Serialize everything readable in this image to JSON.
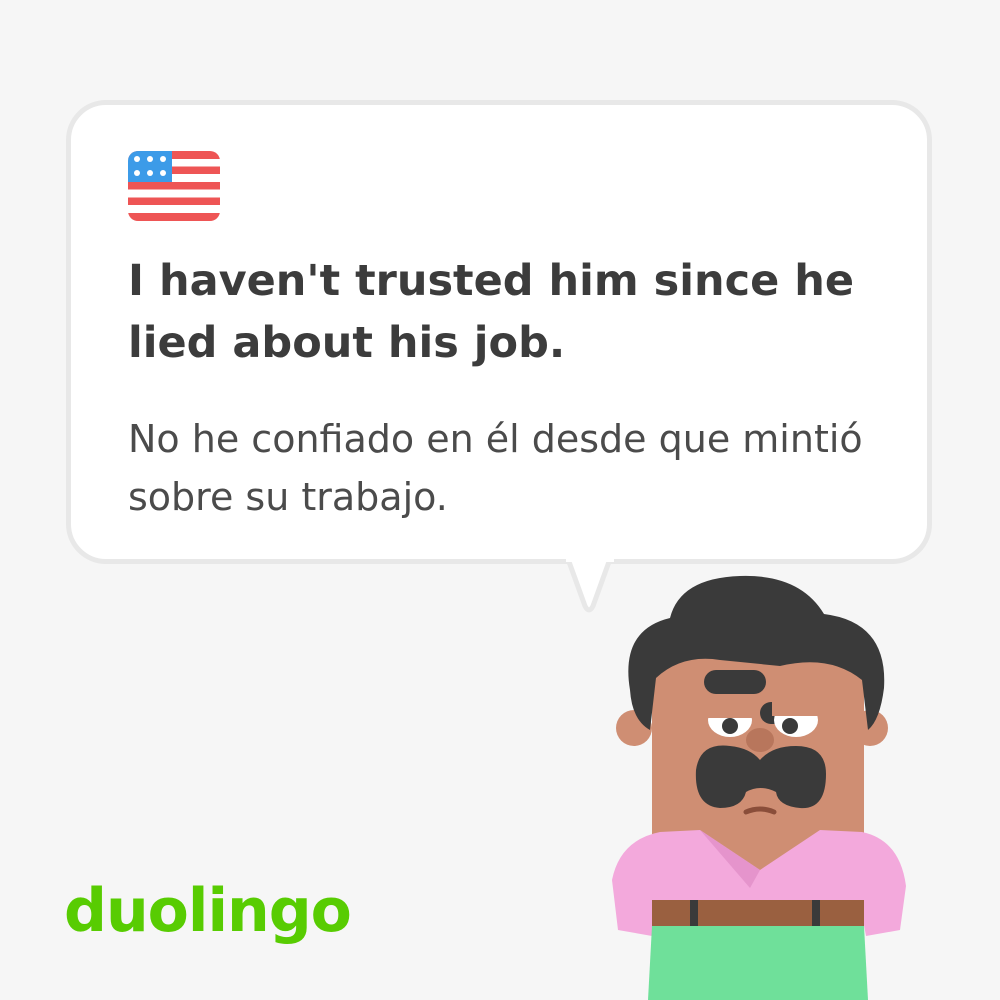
{
  "card": {
    "source_flag": "us-flag-icon",
    "english_sentence": "I haven't trusted him since he lied about his job.",
    "spanish_sentence": "No he confiado en él desde que mintió sobre su trabajo."
  },
  "brand": {
    "logo_text": "duolingo",
    "logo_color": "#58cc02"
  },
  "character": {
    "name_icon": "oscar-character-illustration",
    "shirt_color": "#f3a9dc",
    "pants_color": "#6fe09a",
    "skin_color": "#cf8e73",
    "hair_color": "#3a3a3a"
  },
  "colors": {
    "background": "#f6f6f6",
    "bubble_fill": "#ffffff",
    "bubble_border": "#e8e8e8",
    "text_primary": "#3c3c3c"
  }
}
